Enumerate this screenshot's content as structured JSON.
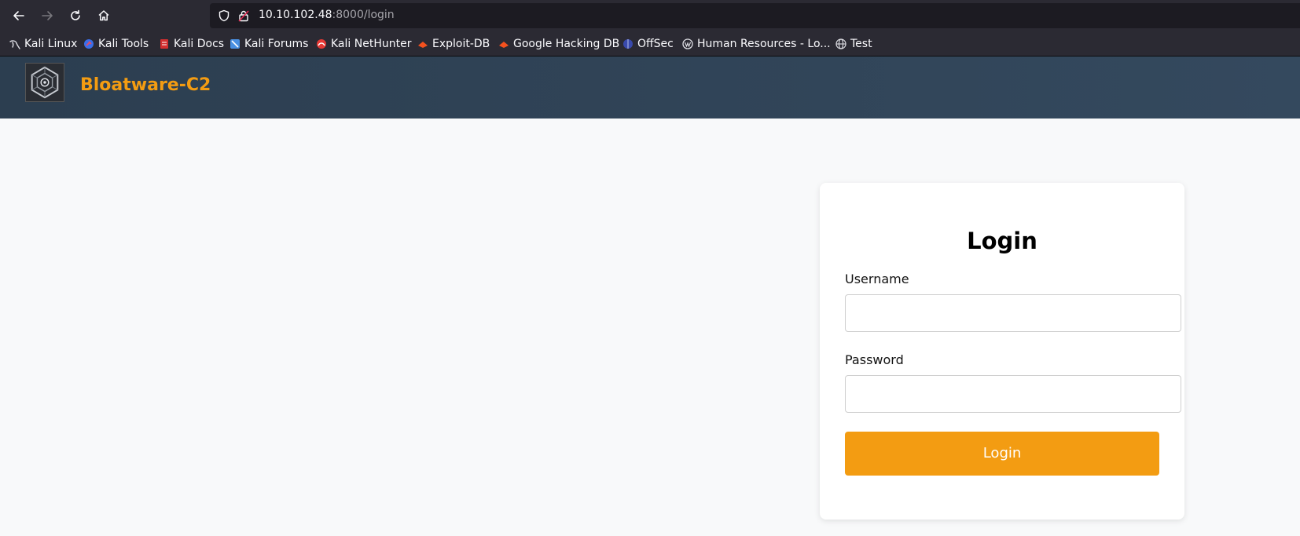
{
  "browser": {
    "url_host": "10.10.102.48",
    "url_path": ":8000/login",
    "bookmarks": [
      {
        "label": "Kali Linux",
        "icon": "kali-dragon-icon"
      },
      {
        "label": "Kali Tools",
        "icon": "kali-tools-icon"
      },
      {
        "label": "Kali Docs",
        "icon": "kali-docs-icon"
      },
      {
        "label": "Kali Forums",
        "icon": "kali-forums-icon"
      },
      {
        "label": "Kali NetHunter",
        "icon": "kali-nethunter-icon"
      },
      {
        "label": "Exploit-DB",
        "icon": "exploit-db-icon"
      },
      {
        "label": "Google Hacking DB",
        "icon": "ghdb-icon"
      },
      {
        "label": "OffSec",
        "icon": "offsec-icon"
      },
      {
        "label": "Human Resources - Lo...",
        "icon": "wordpress-icon"
      },
      {
        "label": "Test",
        "icon": "globe-icon"
      }
    ]
  },
  "site": {
    "brand": "Bloatware-C2",
    "brand_color": "#f39c12",
    "header_color": "#2c3e50"
  },
  "login": {
    "title": "Login",
    "username_label": "Username",
    "username_value": "",
    "password_label": "Password",
    "password_value": "",
    "submit_label": "Login"
  }
}
